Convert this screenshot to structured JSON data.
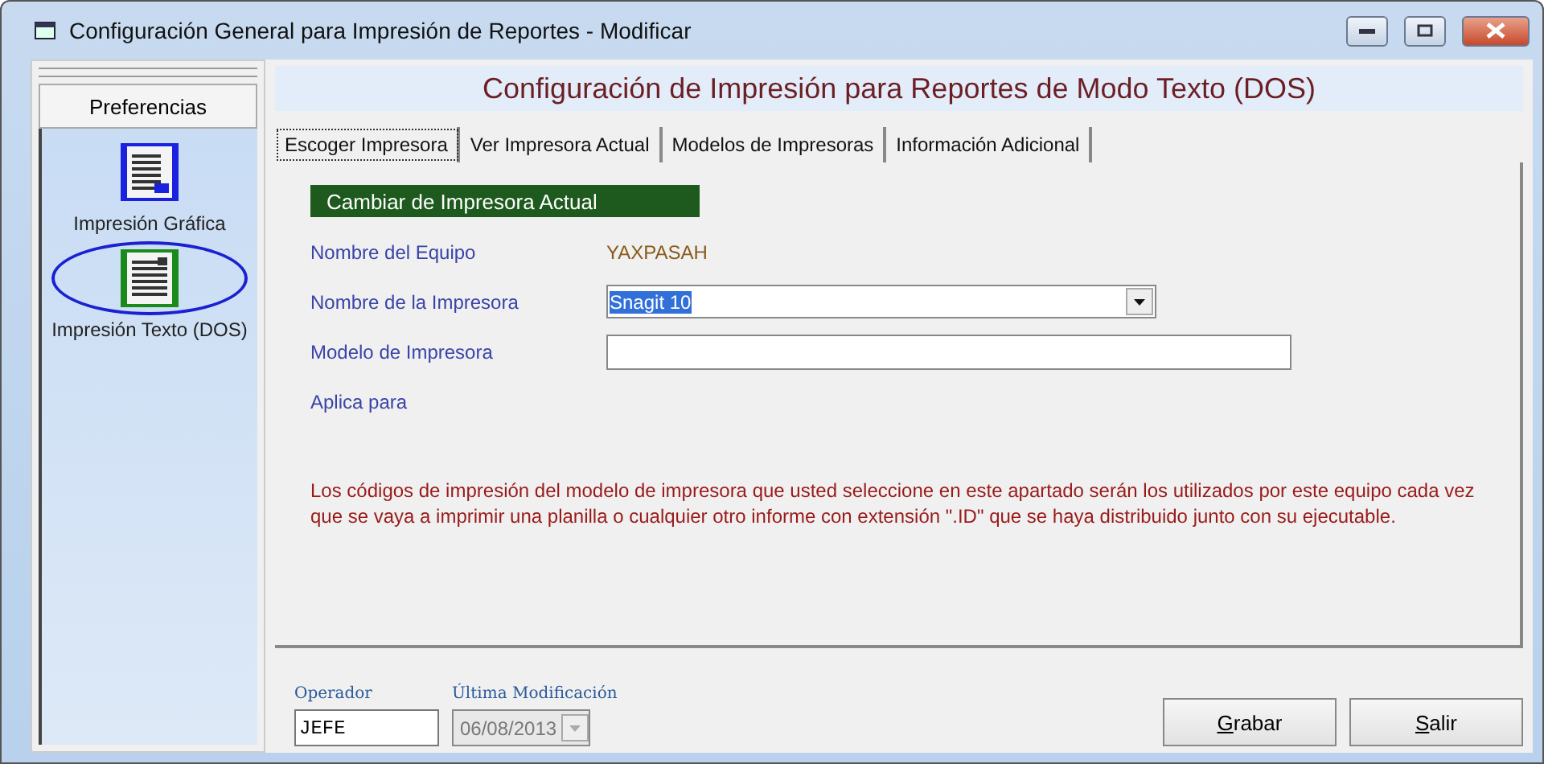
{
  "window": {
    "title": "Configuración General para Impresión de Reportes - Modificar"
  },
  "sidebar": {
    "header": "Preferencias",
    "items": [
      {
        "label": "Impresión Gráfica",
        "kind": "graphic",
        "selected": false
      },
      {
        "label": "Impresión Texto (DOS)",
        "kind": "text",
        "selected": true
      }
    ]
  },
  "heading": "Configuración de Impresión para Reportes de Modo Texto (DOS)",
  "tabs": [
    {
      "label": "Escoger Impresora",
      "selected": true
    },
    {
      "label": "Ver Impresora Actual",
      "selected": false
    },
    {
      "label": "Modelos de Impresoras",
      "selected": false
    },
    {
      "label": "Información Adicional",
      "selected": false
    }
  ],
  "section_title": "Cambiar de Impresora Actual",
  "fields": [
    {
      "label": "Nombre del Equipo",
      "kind": "text",
      "value": "YAXPASAH"
    },
    {
      "label": "Nombre de la Impresora",
      "kind": "dropdown",
      "value": "Snagit 10"
    },
    {
      "label": "Modelo de Impresora",
      "kind": "input"
    },
    {
      "label": "Aplica para",
      "kind": "label"
    }
  ],
  "note": "Los códigos de impresión del modelo de impresora que usted seleccione en este apartado serán los utilizados por este equipo cada vez que se vaya a imprimir una planilla  o cualquier otro informe con extensión \".ID\" que se haya distribuido junto con su ejecutable.",
  "footer": {
    "operator": {
      "label": "Operador",
      "value": "JEFE"
    },
    "modified": {
      "label": "Última Modificación",
      "value": "06/08/2013",
      "disabled": true
    }
  },
  "buttons": [
    "Grabar",
    "Salir"
  ]
}
